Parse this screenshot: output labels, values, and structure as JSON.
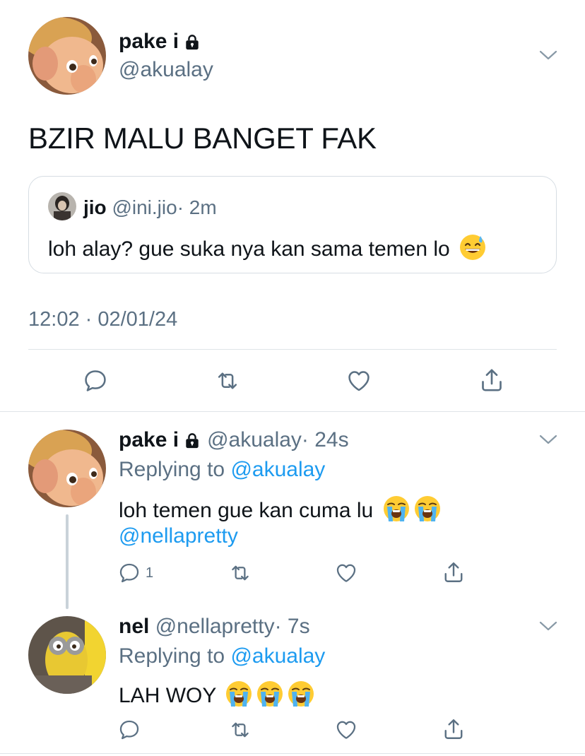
{
  "main_tweet": {
    "display_name": "pake i",
    "handle": "@akualay",
    "text": "BZIR MALU BANGET FAK",
    "timestamp": "12:02 · 02/01/24",
    "quoted": {
      "name": "jio",
      "handle": "@ini.jio",
      "time": "· 2m",
      "text": "loh alay? gue suka nya kan sama temen lo",
      "emoji": "grinning-sweat-emoji"
    }
  },
  "replies": [
    {
      "display_name": "pake i",
      "handle": "@akualay",
      "time": "· 24s",
      "replying_prefix": "Replying to",
      "replying_to": "@akualay",
      "text": "loh temen gue kan cuma lu",
      "emojis": [
        "loudly-crying-emoji",
        "loudly-crying-emoji"
      ],
      "mention": "@nellapretty",
      "reply_count": "1"
    },
    {
      "display_name": "nel",
      "handle": "@nellapretty",
      "time": "· 7s",
      "replying_prefix": "Replying to",
      "replying_to": "@akualay",
      "text": "LAH WOY",
      "emojis": [
        "loudly-crying-emoji",
        "loudly-crying-emoji",
        "loudly-crying-emoji"
      ]
    }
  ],
  "colors": {
    "link": "#1d9bf0",
    "muted": "#5b7083",
    "divider": "#dfe4e8",
    "icon": "#5b7083"
  },
  "icons": [
    "lock-icon",
    "chevron-down-icon",
    "reply-icon",
    "retweet-icon",
    "like-icon",
    "share-icon"
  ]
}
